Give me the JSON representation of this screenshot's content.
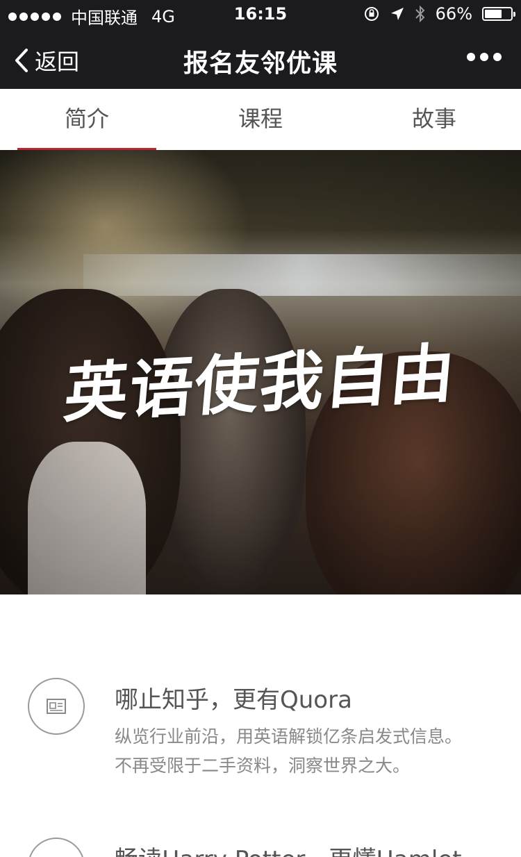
{
  "status_bar": {
    "carrier": "中国联通",
    "network": "4G",
    "time": "16:15",
    "battery": "66%",
    "battery_level": 0.66
  },
  "nav": {
    "back_label": "返回",
    "title": "报名友邻优课"
  },
  "tabs": [
    {
      "label": "简介",
      "active": true
    },
    {
      "label": "课程",
      "active": false
    },
    {
      "label": "故事",
      "active": false
    }
  ],
  "hero": {
    "caption": "英语使我自由"
  },
  "features": [
    {
      "icon": "newspaper-icon",
      "title": "哪止知乎，更有Quora",
      "desc_line1": "纵览行业前沿，用英语解锁亿条启发式信息。",
      "desc_line2": "不再受限于二手资料，洞察世界之大。"
    },
    {
      "icon": "book-icon",
      "title": "畅读Harry Potter，更懂Hamlet"
    }
  ],
  "colors": {
    "bar_bg": "#1b1a1f",
    "tab_indicator": "#b82633"
  }
}
